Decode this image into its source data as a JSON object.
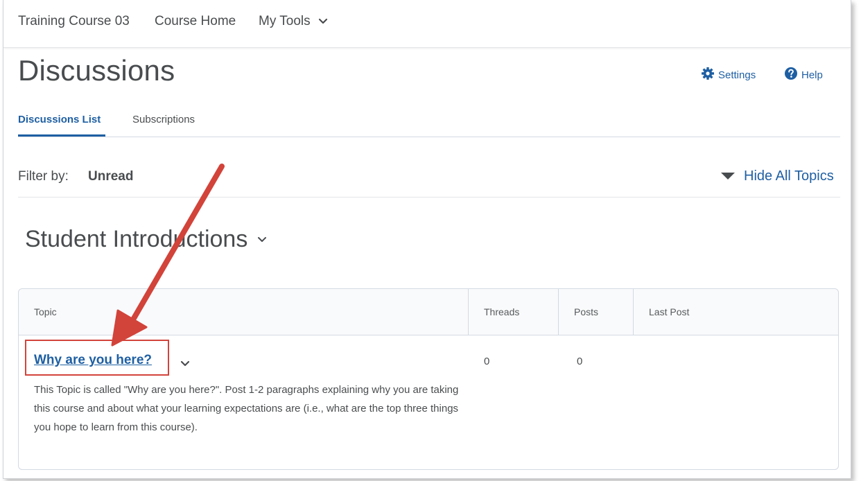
{
  "navbar": {
    "course_name": "Training Course 03",
    "course_home": "Course Home",
    "my_tools": "My Tools"
  },
  "page": {
    "title": "Discussions",
    "settings": "Settings",
    "help": "Help"
  },
  "tabs": [
    {
      "label": "Discussions List",
      "active": true
    },
    {
      "label": "Subscriptions",
      "active": false
    }
  ],
  "filter": {
    "label": "Filter by:",
    "value": "Unread",
    "hide_all": "Hide All Topics"
  },
  "forum": {
    "title": "Student Introductions"
  },
  "table": {
    "columns": [
      "Topic",
      "Threads",
      "Posts",
      "Last Post"
    ],
    "rows": [
      {
        "topic": "Why are you here?",
        "threads": "0",
        "posts": "0",
        "last_post": "",
        "description": "This Topic is called \"Why are you here?\".  Post 1-2 paragraphs explaining why you are taking this course and about what your learning expectations are (i.e., what are the top three things you hope to learn from this course)."
      }
    ]
  },
  "colors": {
    "link": "#1e5fa3",
    "text": "#494c4e",
    "annotation": "#d2433a"
  },
  "icons": [
    "chevron-down-icon",
    "gear-icon",
    "help-circle-icon",
    "caret-down-icon"
  ]
}
